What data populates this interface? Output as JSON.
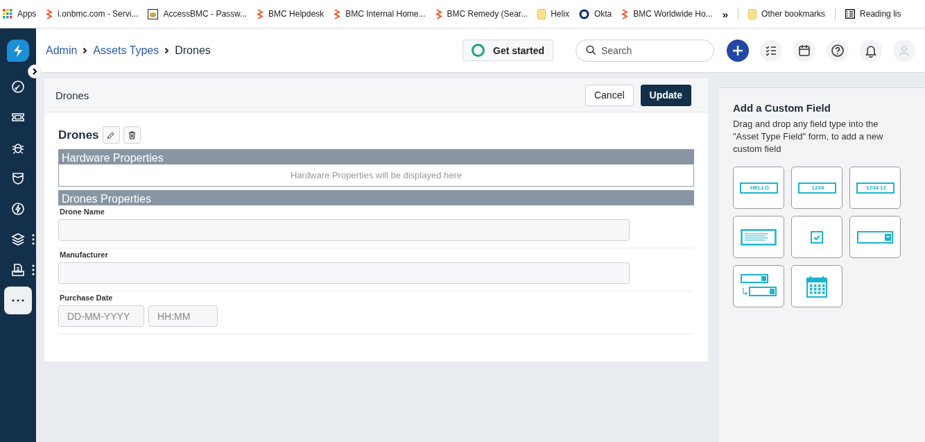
{
  "bookmarks": [
    {
      "kind": "apps",
      "label": "Apps"
    },
    {
      "kind": "bmc",
      "label": "i.onbmc.com - Servi..."
    },
    {
      "kind": "cat",
      "label": "AccessBMC - Passw..."
    },
    {
      "kind": "bmc",
      "label": "BMC Helpdesk"
    },
    {
      "kind": "bmc",
      "label": "BMC Internal Home..."
    },
    {
      "kind": "bmc",
      "label": "BMC Remedy (Sear..."
    },
    {
      "kind": "folder",
      "label": "Helix"
    },
    {
      "kind": "okta",
      "label": "Okta"
    },
    {
      "kind": "bmc",
      "label": "BMC Worldwide Ho..."
    },
    {
      "kind": "more",
      "label": "»"
    },
    {
      "kind": "folder",
      "label": "Other bookmarks"
    },
    {
      "kind": "reading",
      "label": "Reading lis"
    }
  ],
  "nav": [
    {
      "kind": "gauge",
      "selected": false,
      "menu": false
    },
    {
      "kind": "ticket",
      "selected": false,
      "menu": false
    },
    {
      "kind": "bug",
      "selected": false,
      "menu": false
    },
    {
      "kind": "shield",
      "selected": false,
      "menu": false
    },
    {
      "kind": "bolt",
      "selected": false,
      "menu": false
    },
    {
      "kind": "layers",
      "selected": false,
      "menu": true
    },
    {
      "kind": "doc",
      "selected": false,
      "menu": true
    },
    {
      "kind": "more",
      "selected": true,
      "menu": false
    }
  ],
  "breadcrumb": [
    {
      "label": "Admin",
      "link": true
    },
    {
      "label": "Assets Types",
      "link": true
    },
    {
      "label": "Drones",
      "link": false
    }
  ],
  "get_started": "Get started",
  "search": {
    "placeholder": "Search"
  },
  "header_icons": [
    {
      "kind": "add"
    },
    {
      "kind": "checklist"
    },
    {
      "kind": "calendar"
    },
    {
      "kind": "help"
    },
    {
      "kind": "bell"
    },
    {
      "kind": "user"
    }
  ],
  "card": {
    "title": "Drones",
    "cancel": "Cancel",
    "update": "Update",
    "name": "Drones",
    "sections": [
      {
        "kind": "empty",
        "title": "Hardware Properties",
        "note": "Hardware Properties will be displayed here"
      },
      {
        "kind": "fields",
        "title": "Drones Properties",
        "fields": [
          {
            "kind": "text",
            "label": "Drone Name"
          },
          {
            "kind": "text",
            "label": "Manufacturer"
          },
          {
            "kind": "datetime",
            "label": "Purchase Date",
            "placeholder": "DD-MM-YYYY",
            "time_placeholder": "HH:MM"
          }
        ]
      }
    ]
  },
  "palette": {
    "title": "Add a Custom Field",
    "description": "Drag and drop any field type into the \"Asset Type Field\" form, to add a new custom field",
    "items": [
      {
        "kind": "text",
        "sample": "HELLO"
      },
      {
        "kind": "number",
        "sample": "1234"
      },
      {
        "kind": "decimal",
        "sample": "1234.12"
      },
      {
        "kind": "textarea"
      },
      {
        "kind": "checkbox"
      },
      {
        "kind": "dropdown"
      },
      {
        "kind": "dependent"
      },
      {
        "kind": "date"
      }
    ]
  }
}
